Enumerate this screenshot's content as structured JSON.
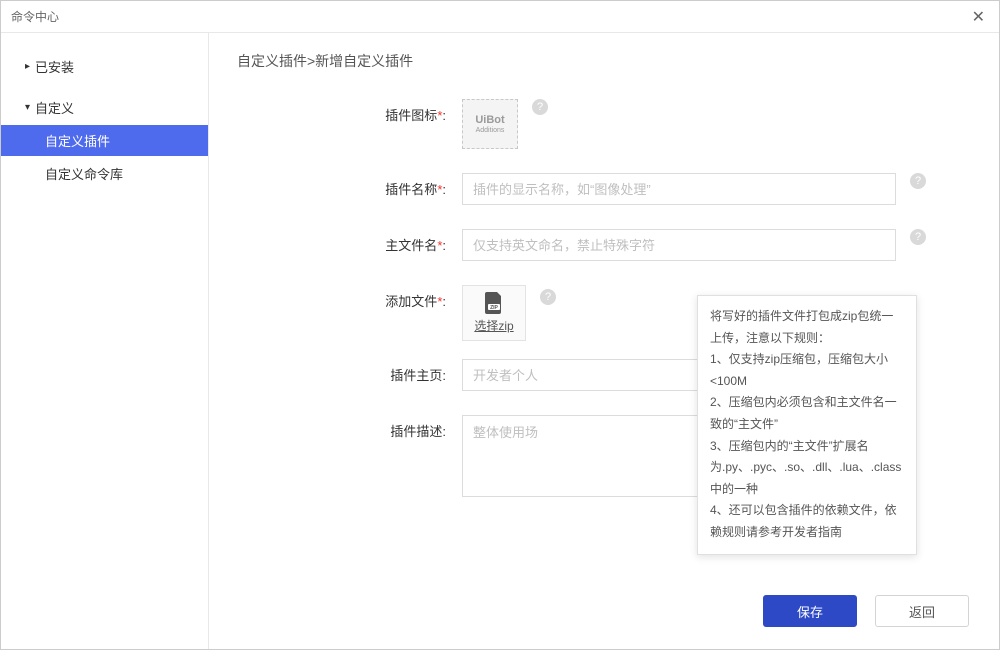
{
  "window": {
    "title": "命令中心"
  },
  "sidebar": {
    "installed": "已安装",
    "custom": "自定义",
    "customPlugin": "自定义插件",
    "customLib": "自定义命令库"
  },
  "breadcrumb": "自定义插件>新增自定义插件",
  "form": {
    "iconLabel": "插件图标",
    "iconBadge1": "UiBot",
    "iconBadge2": "Additions",
    "nameLabel": "插件名称",
    "namePlaceholder": "插件的显示名称，如“图像处理”",
    "mainFileLabel": "主文件名",
    "mainFilePlaceholder": "仅支持英文命名，禁止特殊字符",
    "addFileLabel": "添加文件",
    "zipLink": "选择zip",
    "homeLabel": "插件主页",
    "homePlaceholder": "开发者个人",
    "descLabel": "插件描述",
    "descPlaceholder": "整体使用场"
  },
  "tooltip": {
    "line1": "将写好的插件文件打包成zip包统一上传，注意以下规则：",
    "line2": "1、仅支持zip压缩包，压缩包大小<100M",
    "line3": "2、压缩包内必须包含和主文件名一致的“主文件”",
    "line4": "3、压缩包内的“主文件”扩展名为.py、.pyc、.so、.dll、.lua、.class中的一种",
    "line5": "4、还可以包含插件的依赖文件，依赖规则请参考开发者指南"
  },
  "footer": {
    "save": "保存",
    "back": "返回"
  }
}
